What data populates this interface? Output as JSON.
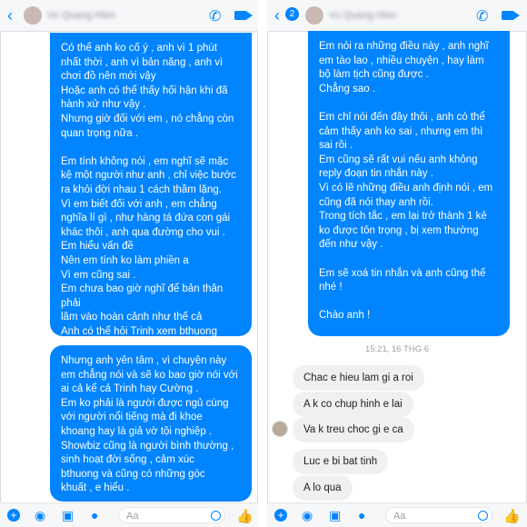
{
  "left": {
    "header": {
      "contact_name": "Vu Quang Hien"
    },
    "bubble_1": "Có thể anh ko cố ý , anh vì 1 phút\nnhất thời , anh vì bản năng , anh vì\nchơi đồ nên mới vậy\nHoặc anh có thể thấy hối hận khi đã\nhành xử như vậy .\nNhưng giờ đối với em , nó chẳng còn\nquan trọng nữa .\n\nEm tính không nói , em nghĩ sẽ mặc\nkệ một người như anh , chỉ việc bước\nra khỏi đời nhau 1 cách thầm lặng.\nVì em biết đối với anh , em chẳng\nnghĩa lí gì , như hàng tá đứa con gái\nkhác thôi , anh qua đường cho vui .\nEm hiểu vấn đề\nNên em tính ko làm phiền a\nVì em cũng sai .\nEm chưa bao giờ nghĩ để bản thân phải\nlâm vào hoàn cảnh như thế cả\nAnh có thể hỏi Trinh xem bthuong\nem như thế nào",
    "bubble_2": "Nhưng anh yên tâm , vì chuyện này\nem chẳng nói và sẽ ko bao giờ nói với\nai cả kể cả Trinh hay Cường .\nEm ko phải là người được ngủ cùng\nvới người nổi tiếng mà đi khoe\nkhoang hay là giả vờ tội nghiệp .\nShowbiz cũng là người bình thường ,\nsinh hoạt đời sống , cảm xúc\nbthuong và cũng có những góc\nkhuất , e hiểu .",
    "footer": {
      "placeholder": "Aa"
    }
  },
  "right": {
    "header": {
      "contact_name": "Vu Quang Hien",
      "badge": "2"
    },
    "bubble_1": "Em nói ra những điều này , anh nghĩ\nem tào lao , nhiều chuyện , hay làm\nbộ làm tịch cũng được .\nChẳng sao .\n\nEm chỉ nói đến đây thôi , anh có thể\ncảm thấy anh ko sai , nhưng em thì\nsai rồi .\nEm cũng sẽ rất vui nếu anh không\nreply đoạn tin nhắn này .\nVì có lẽ những điều anh định nói , em\ncũng đã nói thay anh rồi.\nTrong tích tắc , em lại trở thành 1 kẻ\nko được tôn trọng , bị xem thường\nđến như vậy .\n\nEm sẽ xoá tin nhắn và anh cũng thế\nnhé !\n\nChào anh !",
    "timestamp": "15:21, 16 THG 6",
    "replies": [
      "Chac e hieu lam gi a roi",
      "A k co chup hinh e lai",
      "Va k treu choc gi e ca",
      "Luc e bi bat tinh",
      "A lo qua"
    ],
    "footer": {
      "placeholder": "Aa"
    }
  }
}
